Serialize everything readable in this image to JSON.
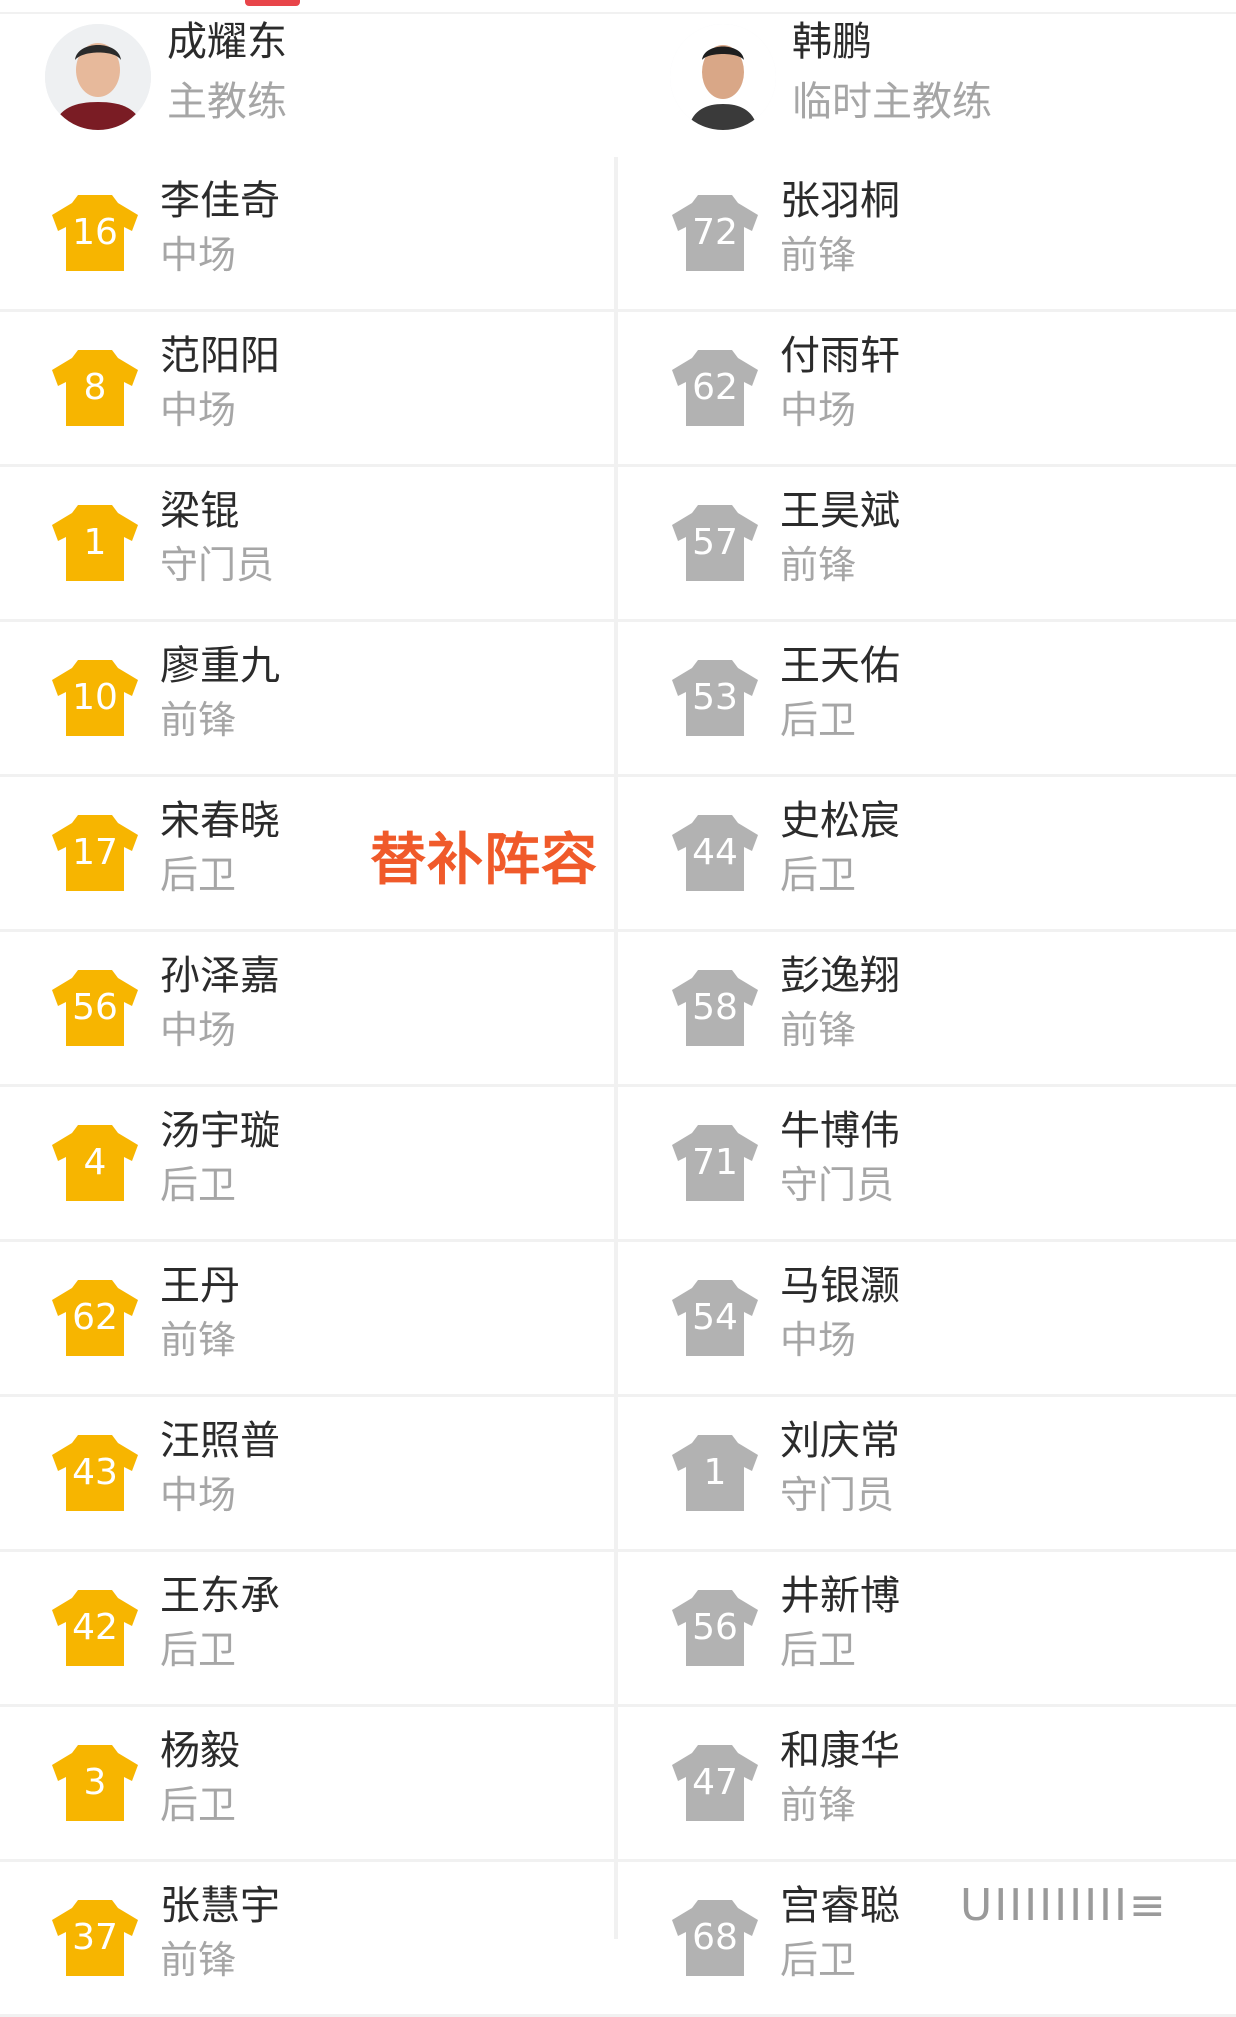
{
  "colors": {
    "home_shirt": "#f7b500",
    "away_shirt": "#b2b2b2",
    "overlay_text": "#f05a2a"
  },
  "coaches": {
    "home": {
      "name": "成耀东",
      "role": "主教练",
      "icon": "coach-avatar"
    },
    "away": {
      "name": "韩鹏",
      "role": "临时主教练",
      "icon": "coach-avatar"
    }
  },
  "overlay_label": "替补阵容",
  "watermark": "UIIIIIIIII≡",
  "rows": [
    {
      "home": {
        "number": "16",
        "name": "李佳奇",
        "position": "中场"
      },
      "away": {
        "number": "72",
        "name": "张羽桐",
        "position": "前锋"
      }
    },
    {
      "home": {
        "number": "8",
        "name": "范阳阳",
        "position": "中场"
      },
      "away": {
        "number": "62",
        "name": "付雨轩",
        "position": "中场"
      }
    },
    {
      "home": {
        "number": "1",
        "name": "梁锟",
        "position": "守门员"
      },
      "away": {
        "number": "57",
        "name": "王昊斌",
        "position": "前锋"
      }
    },
    {
      "home": {
        "number": "10",
        "name": "廖重九",
        "position": "前锋"
      },
      "away": {
        "number": "53",
        "name": "王天佑",
        "position": "后卫"
      }
    },
    {
      "home": {
        "number": "17",
        "name": "宋春晓",
        "position": "后卫"
      },
      "away": {
        "number": "44",
        "name": "史松宸",
        "position": "后卫"
      }
    },
    {
      "home": {
        "number": "56",
        "name": "孙泽嘉",
        "position": "中场"
      },
      "away": {
        "number": "58",
        "name": "彭逸翔",
        "position": "前锋"
      }
    },
    {
      "home": {
        "number": "4",
        "name": "汤宇璇",
        "position": "后卫"
      },
      "away": {
        "number": "71",
        "name": "牛博伟",
        "position": "守门员"
      }
    },
    {
      "home": {
        "number": "62",
        "name": "王丹",
        "position": "前锋"
      },
      "away": {
        "number": "54",
        "name": "马银灏",
        "position": "中场"
      }
    },
    {
      "home": {
        "number": "43",
        "name": "汪照普",
        "position": "中场"
      },
      "away": {
        "number": "1",
        "name": "刘庆常",
        "position": "守门员"
      }
    },
    {
      "home": {
        "number": "42",
        "name": "王东承",
        "position": "后卫"
      },
      "away": {
        "number": "56",
        "name": "井新博",
        "position": "后卫"
      }
    },
    {
      "home": {
        "number": "3",
        "name": "杨毅",
        "position": "后卫"
      },
      "away": {
        "number": "47",
        "name": "和康华",
        "position": "前锋"
      }
    },
    {
      "home": {
        "number": "37",
        "name": "张慧宇",
        "position": "前锋"
      },
      "away": {
        "number": "68",
        "name": "宫睿聪",
        "position": "后卫"
      }
    }
  ]
}
